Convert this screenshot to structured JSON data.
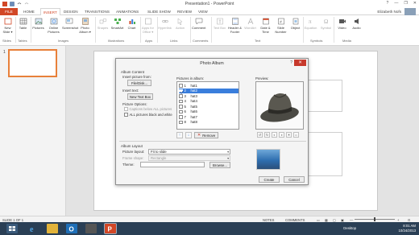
{
  "window": {
    "title": "Presentation1 - PowerPoint",
    "controls": [
      "?",
      "—",
      "❐",
      "✕"
    ]
  },
  "tabs": {
    "file": "FILE",
    "items": [
      "HOME",
      "INSERT",
      "DESIGN",
      "TRANSITIONS",
      "ANIMATIONS",
      "SLIDE SHOW",
      "REVIEW",
      "VIEW"
    ],
    "active": "INSERT",
    "user": "Elizabeth Nofs"
  },
  "ribbon": {
    "items": [
      {
        "label": "New Slide ▾",
        "icon": "new-slide-icon",
        "dim": false
      },
      {
        "label": "Table",
        "icon": "table-icon",
        "dim": false
      },
      {
        "label": "Pictures",
        "icon": "pictures-icon",
        "dim": false
      },
      {
        "label": "Online Pictures",
        "icon": "online-pictures-icon",
        "dim": false
      },
      {
        "label": "Screenshot",
        "icon": "screenshot-icon",
        "dim": false
      },
      {
        "label": "Photo Album ▾",
        "icon": "photo-album-icon",
        "dim": false
      },
      {
        "label": "Shapes",
        "icon": "shapes-icon",
        "dim": true
      },
      {
        "label": "SmartArt",
        "icon": "smartart-icon",
        "dim": false
      },
      {
        "label": "Chart",
        "icon": "chart-icon",
        "dim": false
      },
      {
        "label": "Apps for Office ▾",
        "icon": "apps-icon",
        "dim": true
      },
      {
        "label": "Hyperlink",
        "icon": "hyperlink-icon",
        "dim": true
      },
      {
        "label": "Action",
        "icon": "action-icon",
        "dim": true
      },
      {
        "label": "Comment",
        "icon": "comment-icon",
        "dim": false
      },
      {
        "label": "Text Box",
        "icon": "text-box-icon",
        "dim": true
      },
      {
        "label": "Header & Footer",
        "icon": "header-footer-icon",
        "dim": false
      },
      {
        "label": "WordArt",
        "icon": "wordart-icon",
        "dim": true
      },
      {
        "label": "Date & Time",
        "icon": "date-time-icon",
        "dim": false
      },
      {
        "label": "Slide Number",
        "icon": "slide-number-icon",
        "dim": false
      },
      {
        "label": "Object",
        "icon": "object-icon",
        "dim": false
      },
      {
        "label": "Equation",
        "icon": "equation-icon",
        "dim": true
      },
      {
        "label": "Symbol",
        "icon": "symbol-icon",
        "dim": true
      },
      {
        "label": "Video",
        "icon": "video-icon",
        "dim": false
      },
      {
        "label": "Audio",
        "icon": "audio-icon",
        "dim": false
      }
    ],
    "groups": [
      "Slides",
      "Tables",
      "Images",
      "Illustrations",
      "Apps",
      "Links",
      "Comments",
      "Text",
      "Symbols",
      "Media"
    ]
  },
  "thumbnails": {
    "number": "1"
  },
  "dialog": {
    "title": "Photo Album",
    "help": "?",
    "close": "✕",
    "album_content": "Album Content",
    "insert_picture_from": "Insert picture from:",
    "file_disk_button": "File/Disk...",
    "insert_text": "Insert text:",
    "new_text_box_button": "New Text Box",
    "picture_options": "Picture Options:",
    "captions_label": "Captions below ALL pictures",
    "all_bw_label": "ALL pictures black and white",
    "pictures_in_album": "Pictures in album:",
    "preview_label": "Preview:",
    "pictures": [
      {
        "num": "1",
        "name": "hat1",
        "checked": false,
        "selected": false
      },
      {
        "num": "2",
        "name": "hat2",
        "checked": true,
        "selected": true
      },
      {
        "num": "3",
        "name": "hat3",
        "checked": false,
        "selected": false
      },
      {
        "num": "4",
        "name": "hat4",
        "checked": false,
        "selected": false
      },
      {
        "num": "5",
        "name": "hat5",
        "checked": false,
        "selected": false
      },
      {
        "num": "6",
        "name": "hat6",
        "checked": false,
        "selected": false
      },
      {
        "num": "7",
        "name": "hat7",
        "checked": false,
        "selected": false
      },
      {
        "num": "8",
        "name": "hat8",
        "checked": false,
        "selected": false
      }
    ],
    "move_up": "↑",
    "move_down": "↓",
    "remove_button": "Remove",
    "album_layout": "Album Layout",
    "picture_layout_label": "Picture layout:",
    "picture_layout_value": "Fit to slide",
    "frame_shape_label": "Frame shape:",
    "frame_shape_value": "Rectangle",
    "theme_label": "Theme:",
    "theme_value": "",
    "browse_button": "Browse...",
    "create_button": "Create",
    "cancel_button": "Cancel",
    "colors": {
      "selection": "#3a7edc",
      "close": "#c7392c"
    }
  },
  "statusbar": {
    "slide_info": "SLIDE 1 OF 1",
    "notes": "NOTES",
    "comments": "COMMENTS",
    "zoom": "—"
  },
  "taskbar": {
    "desktop": "Desktop",
    "time": "8:01 AM",
    "date": "10/24/2013",
    "apps": [
      "ie-icon",
      "file-explorer-icon",
      "outlook-icon",
      "media-icon",
      "powerpoint-icon"
    ]
  },
  "colors": {
    "accent": "#d24726",
    "taskbar": "#2a3f55"
  }
}
